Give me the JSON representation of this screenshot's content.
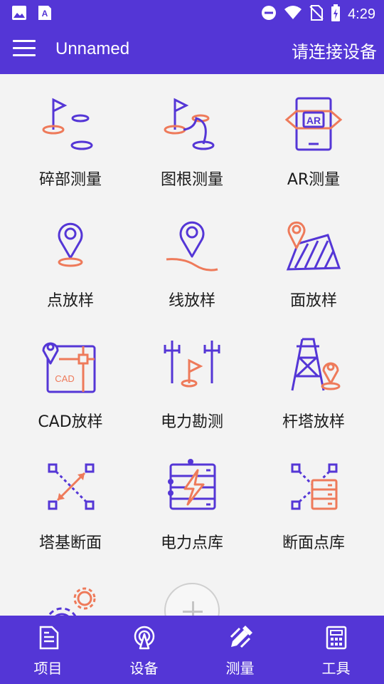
{
  "status_bar": {
    "time": "4:29",
    "icons_left": [
      "image-icon",
      "text-a-icon"
    ],
    "icons_right": [
      "do-not-disturb-icon",
      "wifi-icon",
      "no-sim-icon",
      "battery-charging-icon"
    ]
  },
  "app_bar": {
    "title": "Unnamed",
    "connect_label": "请连接设备"
  },
  "grid": {
    "items": [
      {
        "label": "碎部测量",
        "icon": "flag-points-icon"
      },
      {
        "label": "图根测量",
        "icon": "flag-route-icon"
      },
      {
        "label": "AR测量",
        "icon": "ar-phone-icon"
      },
      {
        "label": "点放样",
        "icon": "map-pin-icon"
      },
      {
        "label": "线放样",
        "icon": "pin-line-icon"
      },
      {
        "label": "面放样",
        "icon": "area-pin-icon"
      },
      {
        "label": "CAD放样",
        "icon": "cad-map-icon"
      },
      {
        "label": "电力勘测",
        "icon": "power-pole-flag-icon"
      },
      {
        "label": "杆塔放样",
        "icon": "tower-pin-icon"
      },
      {
        "label": "塔基断面",
        "icon": "tower-base-section-icon"
      },
      {
        "label": "电力点库",
        "icon": "power-database-icon"
      },
      {
        "label": "断面点库",
        "icon": "section-database-icon"
      }
    ]
  },
  "bottom_nav": {
    "items": [
      {
        "label": "项目",
        "icon": "document-icon"
      },
      {
        "label": "设备",
        "icon": "antenna-icon"
      },
      {
        "label": "测量",
        "icon": "survey-pen-icon"
      },
      {
        "label": "工具",
        "icon": "calculator-icon"
      }
    ]
  },
  "colors": {
    "primary": "#5436d6",
    "accent": "#ee7a5a",
    "background": "#f3f3f3"
  }
}
